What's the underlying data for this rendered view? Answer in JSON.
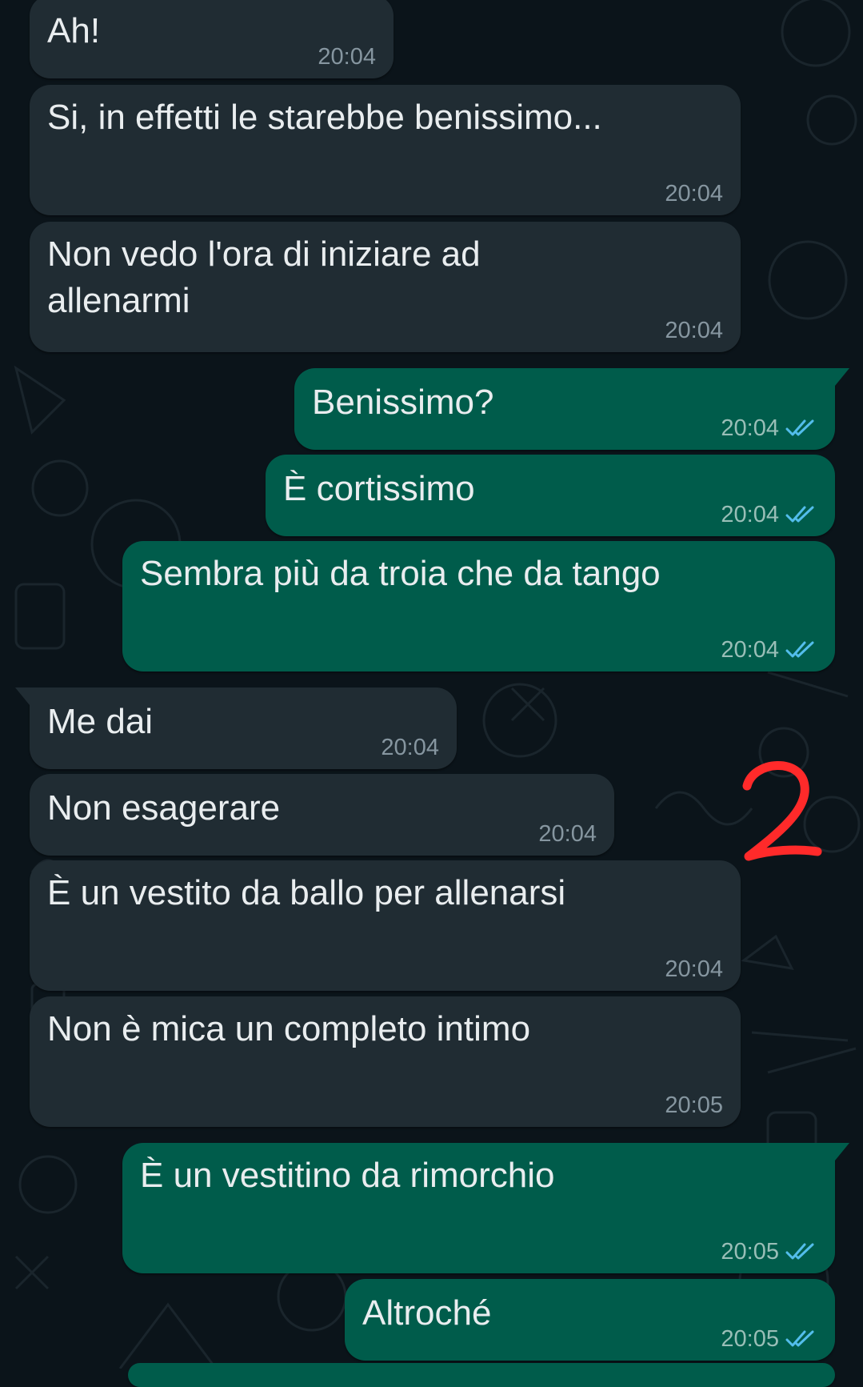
{
  "conversation": {
    "messages": [
      {
        "direction": "incoming",
        "text": "Ah!",
        "time": "20:04"
      },
      {
        "direction": "incoming",
        "text": "Si, in effetti le starebbe benissimo...",
        "time": "20:04"
      },
      {
        "direction": "incoming",
        "text": "Non vedo l'ora di iniziare ad\nallenarmi",
        "time": "20:04"
      },
      {
        "direction": "outgoing",
        "text": "Benissimo?",
        "time": "20:04",
        "status_icon": "double-check-read-icon"
      },
      {
        "direction": "outgoing",
        "text": "È cortissimo",
        "time": "20:04",
        "status_icon": "double-check-read-icon"
      },
      {
        "direction": "outgoing",
        "text": "Sembra più da troia che da tango",
        "time": "20:04",
        "status_icon": "double-check-read-icon"
      },
      {
        "direction": "incoming",
        "text": "Me dai",
        "time": "20:04"
      },
      {
        "direction": "incoming",
        "text": "Non esagerare",
        "time": "20:04"
      },
      {
        "direction": "incoming",
        "text": "È un vestito da ballo per allenarsi",
        "time": "20:04"
      },
      {
        "direction": "incoming",
        "text": "Non è mica un completo intimo",
        "time": "20:05"
      },
      {
        "direction": "outgoing",
        "text": "È un vestitino da rimorchio",
        "time": "20:05",
        "status_icon": "double-check-read-icon"
      },
      {
        "direction": "outgoing",
        "text": "Altroché",
        "time": "20:05",
        "status_icon": "double-check-read-icon"
      }
    ]
  },
  "annotation": {
    "text": "2",
    "color": "#ff2a2a"
  },
  "colors": {
    "background": "#0b141a",
    "incoming_bubble": "#202c33",
    "outgoing_bubble": "#005c4b",
    "read_ticks": "#53bdeb"
  }
}
